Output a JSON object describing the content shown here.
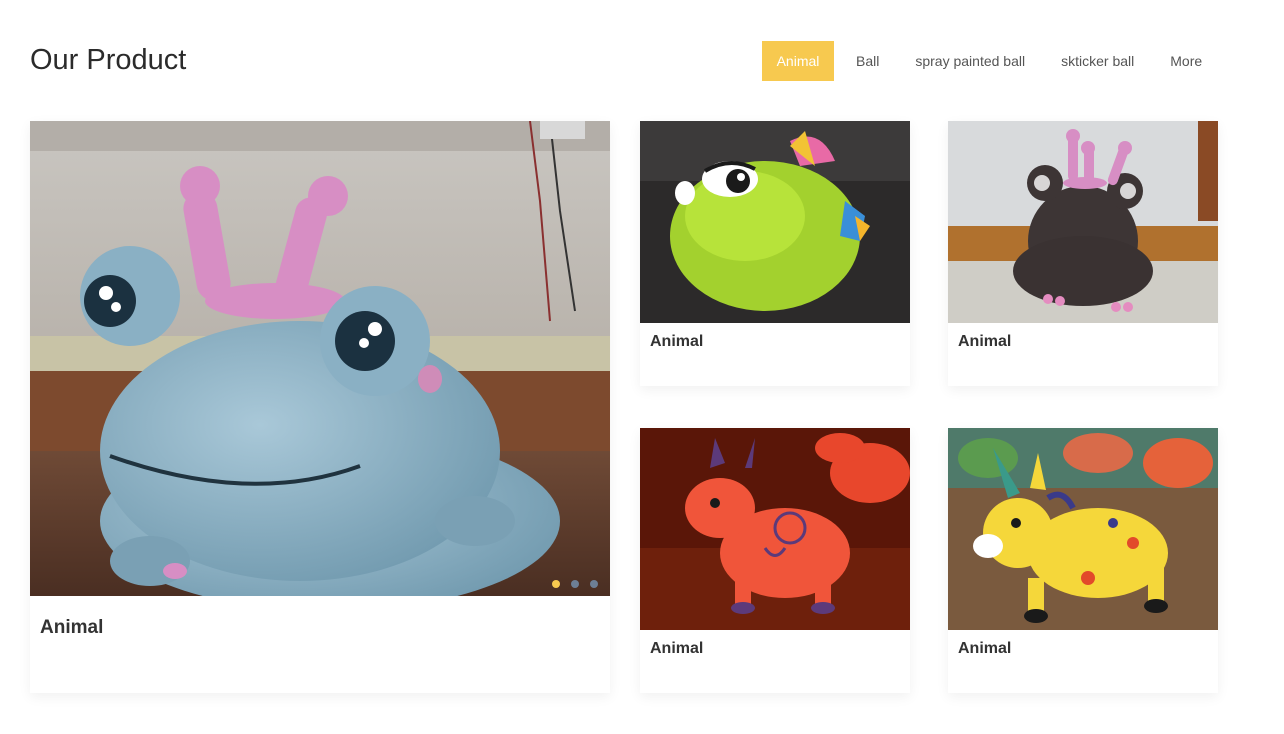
{
  "header": {
    "title": "Our Product"
  },
  "tabs": [
    {
      "label": "Animal",
      "active": true
    },
    {
      "label": "Ball",
      "active": false
    },
    {
      "label": "spray painted ball",
      "active": false
    },
    {
      "label": "skticker ball",
      "active": false
    },
    {
      "label": "More",
      "active": false
    }
  ],
  "products": {
    "featured": {
      "label": "Animal",
      "image": "blue-frog-bouncer-toy"
    },
    "item1": {
      "label": "Animal",
      "image": "green-fish-ball-toy"
    },
    "item2": {
      "label": "Animal",
      "image": "black-frog-bouncer-toy"
    },
    "item3": {
      "label": "Animal",
      "image": "red-cow-bouncer-toy"
    },
    "item4": {
      "label": "Animal",
      "image": "yellow-unicorn-bouncer-toy"
    }
  },
  "carousel": {
    "slide_count": 3,
    "active_index": 0
  },
  "colors": {
    "accent": "#f7c94f",
    "text": "#333333",
    "tab_text": "#555555"
  }
}
